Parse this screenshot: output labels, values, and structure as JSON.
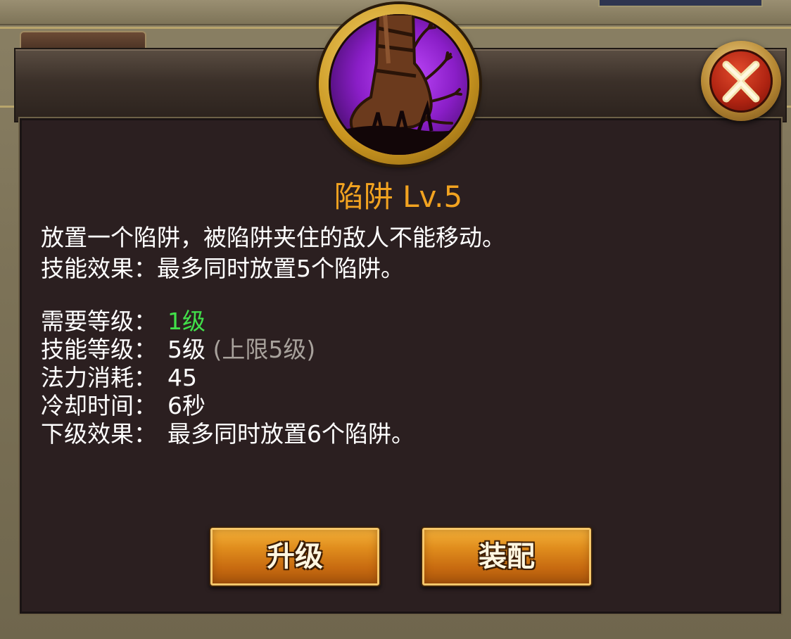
{
  "skill": {
    "icon": "trap-boot-icon",
    "title": "陷阱 Lv.5",
    "description": [
      "放置一个陷阱，被陷阱夹住的敌人不能移动。",
      "技能效果：最多同时放置5个陷阱。"
    ]
  },
  "stats": {
    "required_level": {
      "label": "需要等级：",
      "value": "1级"
    },
    "skill_level": {
      "label": "技能等级：",
      "value": "5级",
      "note": "(上限5级)"
    },
    "mana_cost": {
      "label": "法力消耗：",
      "value": "45"
    },
    "cooldown": {
      "label": "冷却时间：",
      "value": "6秒"
    },
    "next_effect": {
      "label": "下级效果：",
      "value": "最多同时放置6个陷阱。"
    }
  },
  "buttons": {
    "upgrade": "升级",
    "equip": "装配"
  },
  "close_icon": "close-icon",
  "colors": {
    "title": "#f2a320",
    "required_level_value": "#41e04a",
    "note": "#a8a29c",
    "panel": "#2b1f20"
  }
}
